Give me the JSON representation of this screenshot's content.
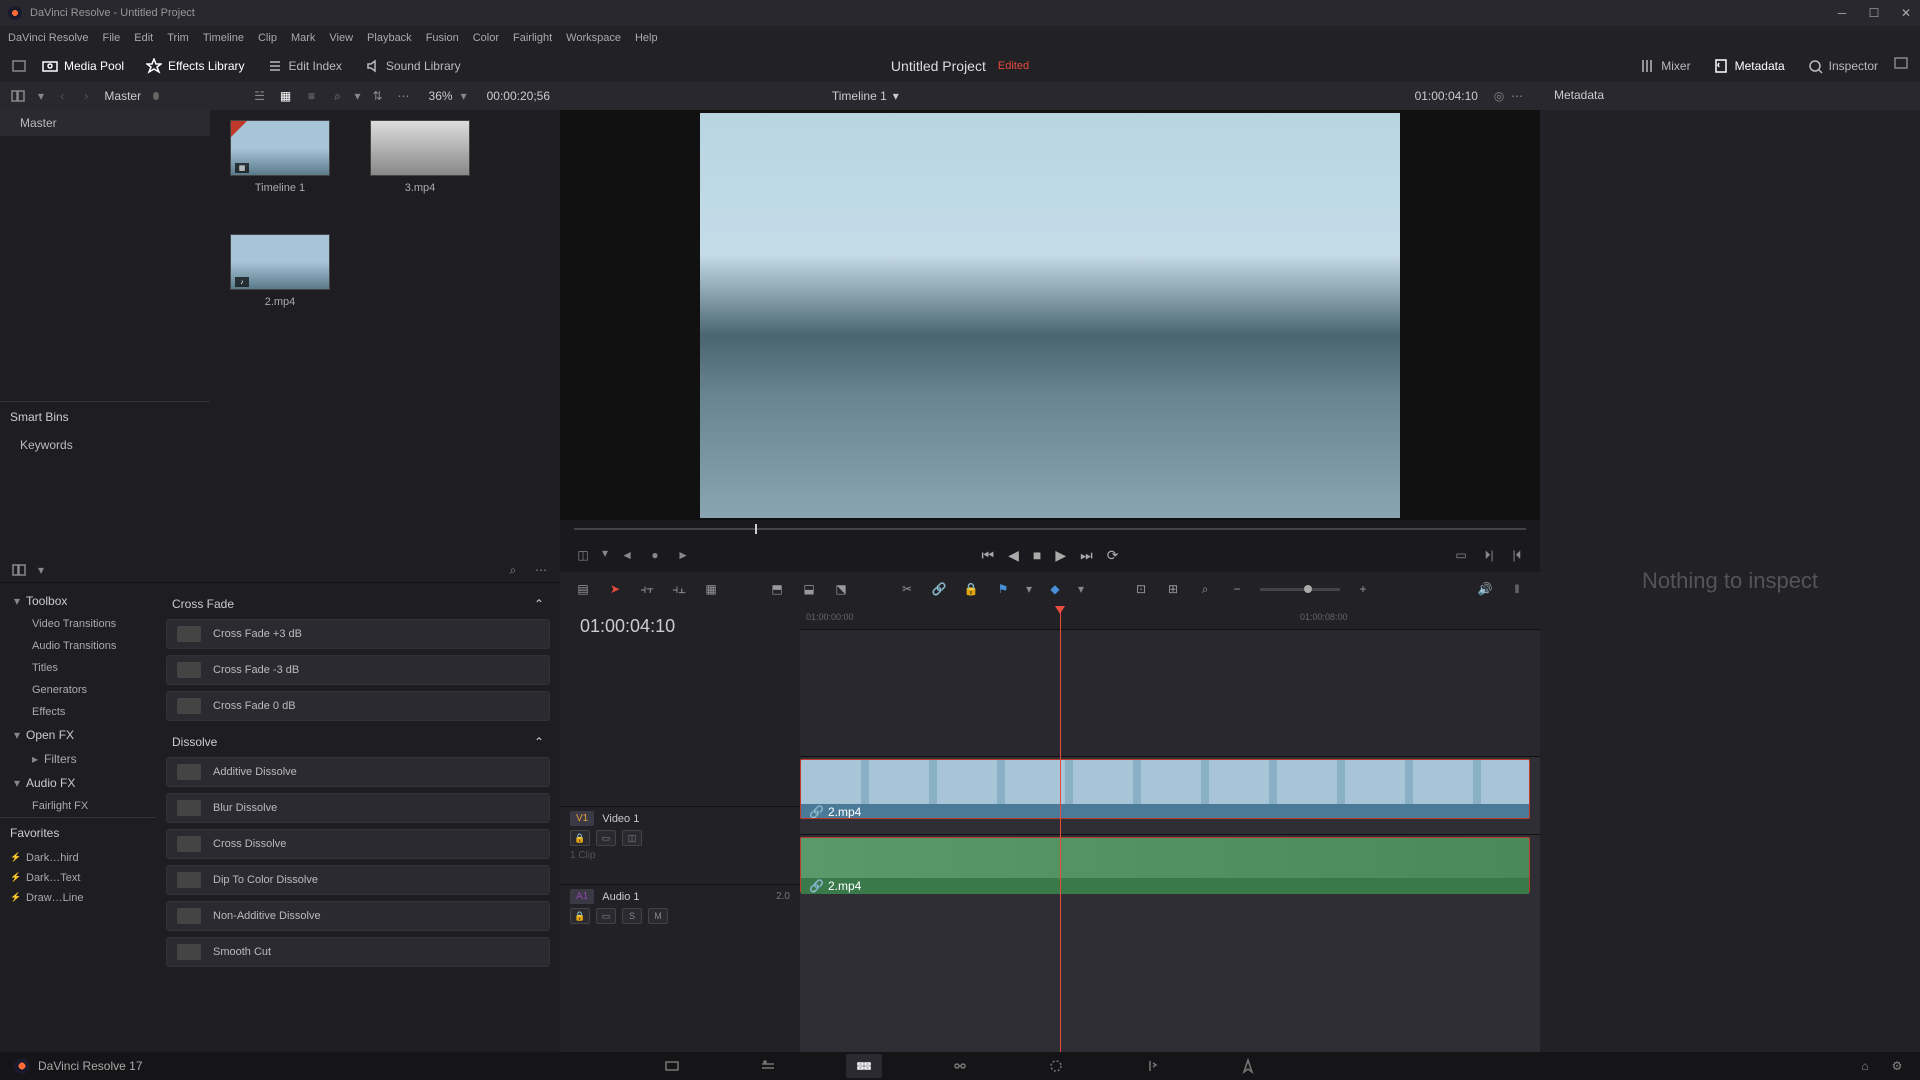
{
  "titlebar": {
    "text": "DaVinci Resolve - Untitled Project"
  },
  "menubar": [
    "DaVinci Resolve",
    "File",
    "Edit",
    "Trim",
    "Timeline",
    "Clip",
    "Mark",
    "View",
    "Playback",
    "Fusion",
    "Color",
    "Fairlight",
    "Workspace",
    "Help"
  ],
  "toolbar": {
    "media_pool": "Media Pool",
    "effects_library": "Effects Library",
    "edit_index": "Edit Index",
    "sound_library": "Sound Library",
    "project_title": "Untitled Project",
    "edited": "Edited",
    "mixer": "Mixer",
    "metadata": "Metadata",
    "inspector": "Inspector"
  },
  "media_header": {
    "breadcrumb": "Master",
    "zoom": "36%",
    "timecode": "00:00:20;56"
  },
  "bins": {
    "master": "Master",
    "smart": "Smart Bins",
    "keywords": "Keywords"
  },
  "clips": [
    {
      "name": "Timeline 1",
      "icon": "▦"
    },
    {
      "name": "3.mp4",
      "icon": ""
    },
    {
      "name": "2.mp4",
      "icon": "♪"
    }
  ],
  "effects": {
    "toolbox": "Toolbox",
    "cats": [
      "Video Transitions",
      "Audio Transitions",
      "Titles",
      "Generators",
      "Effects"
    ],
    "openfx": "Open FX",
    "openfx_sub": [
      "Filters"
    ],
    "audiofx": "Audio FX",
    "audiofx_sub": [
      "Fairlight FX"
    ],
    "favorites": "Favorites",
    "fav_items": [
      "Dark…hird",
      "Dark…Text",
      "Draw…Line"
    ],
    "groups": [
      {
        "name": "Cross Fade",
        "items": [
          "Cross Fade +3 dB",
          "Cross Fade -3 dB",
          "Cross Fade 0 dB"
        ]
      },
      {
        "name": "Dissolve",
        "items": [
          "Additive Dissolve",
          "Blur Dissolve",
          "Cross Dissolve",
          "Dip To Color Dissolve",
          "Non-Additive Dissolve",
          "Smooth Cut"
        ]
      }
    ]
  },
  "viewer": {
    "title": "Timeline 1",
    "tc_right": "01:00:04:10"
  },
  "timeline": {
    "tc": "01:00:04:10",
    "ruler": [
      "01:00:00:00",
      "01:00:08:00"
    ],
    "tracks": {
      "v1": {
        "badge": "V1",
        "name": "Video 1",
        "clip_meta": "1 Clip"
      },
      "a1": {
        "badge": "A1",
        "name": "Audio 1",
        "ch": "2.0"
      }
    },
    "clip_name": "2.mp4"
  },
  "right": {
    "header": "Metadata",
    "empty": "Nothing to inspect"
  },
  "footer": {
    "version": "DaVinci Resolve 17"
  }
}
